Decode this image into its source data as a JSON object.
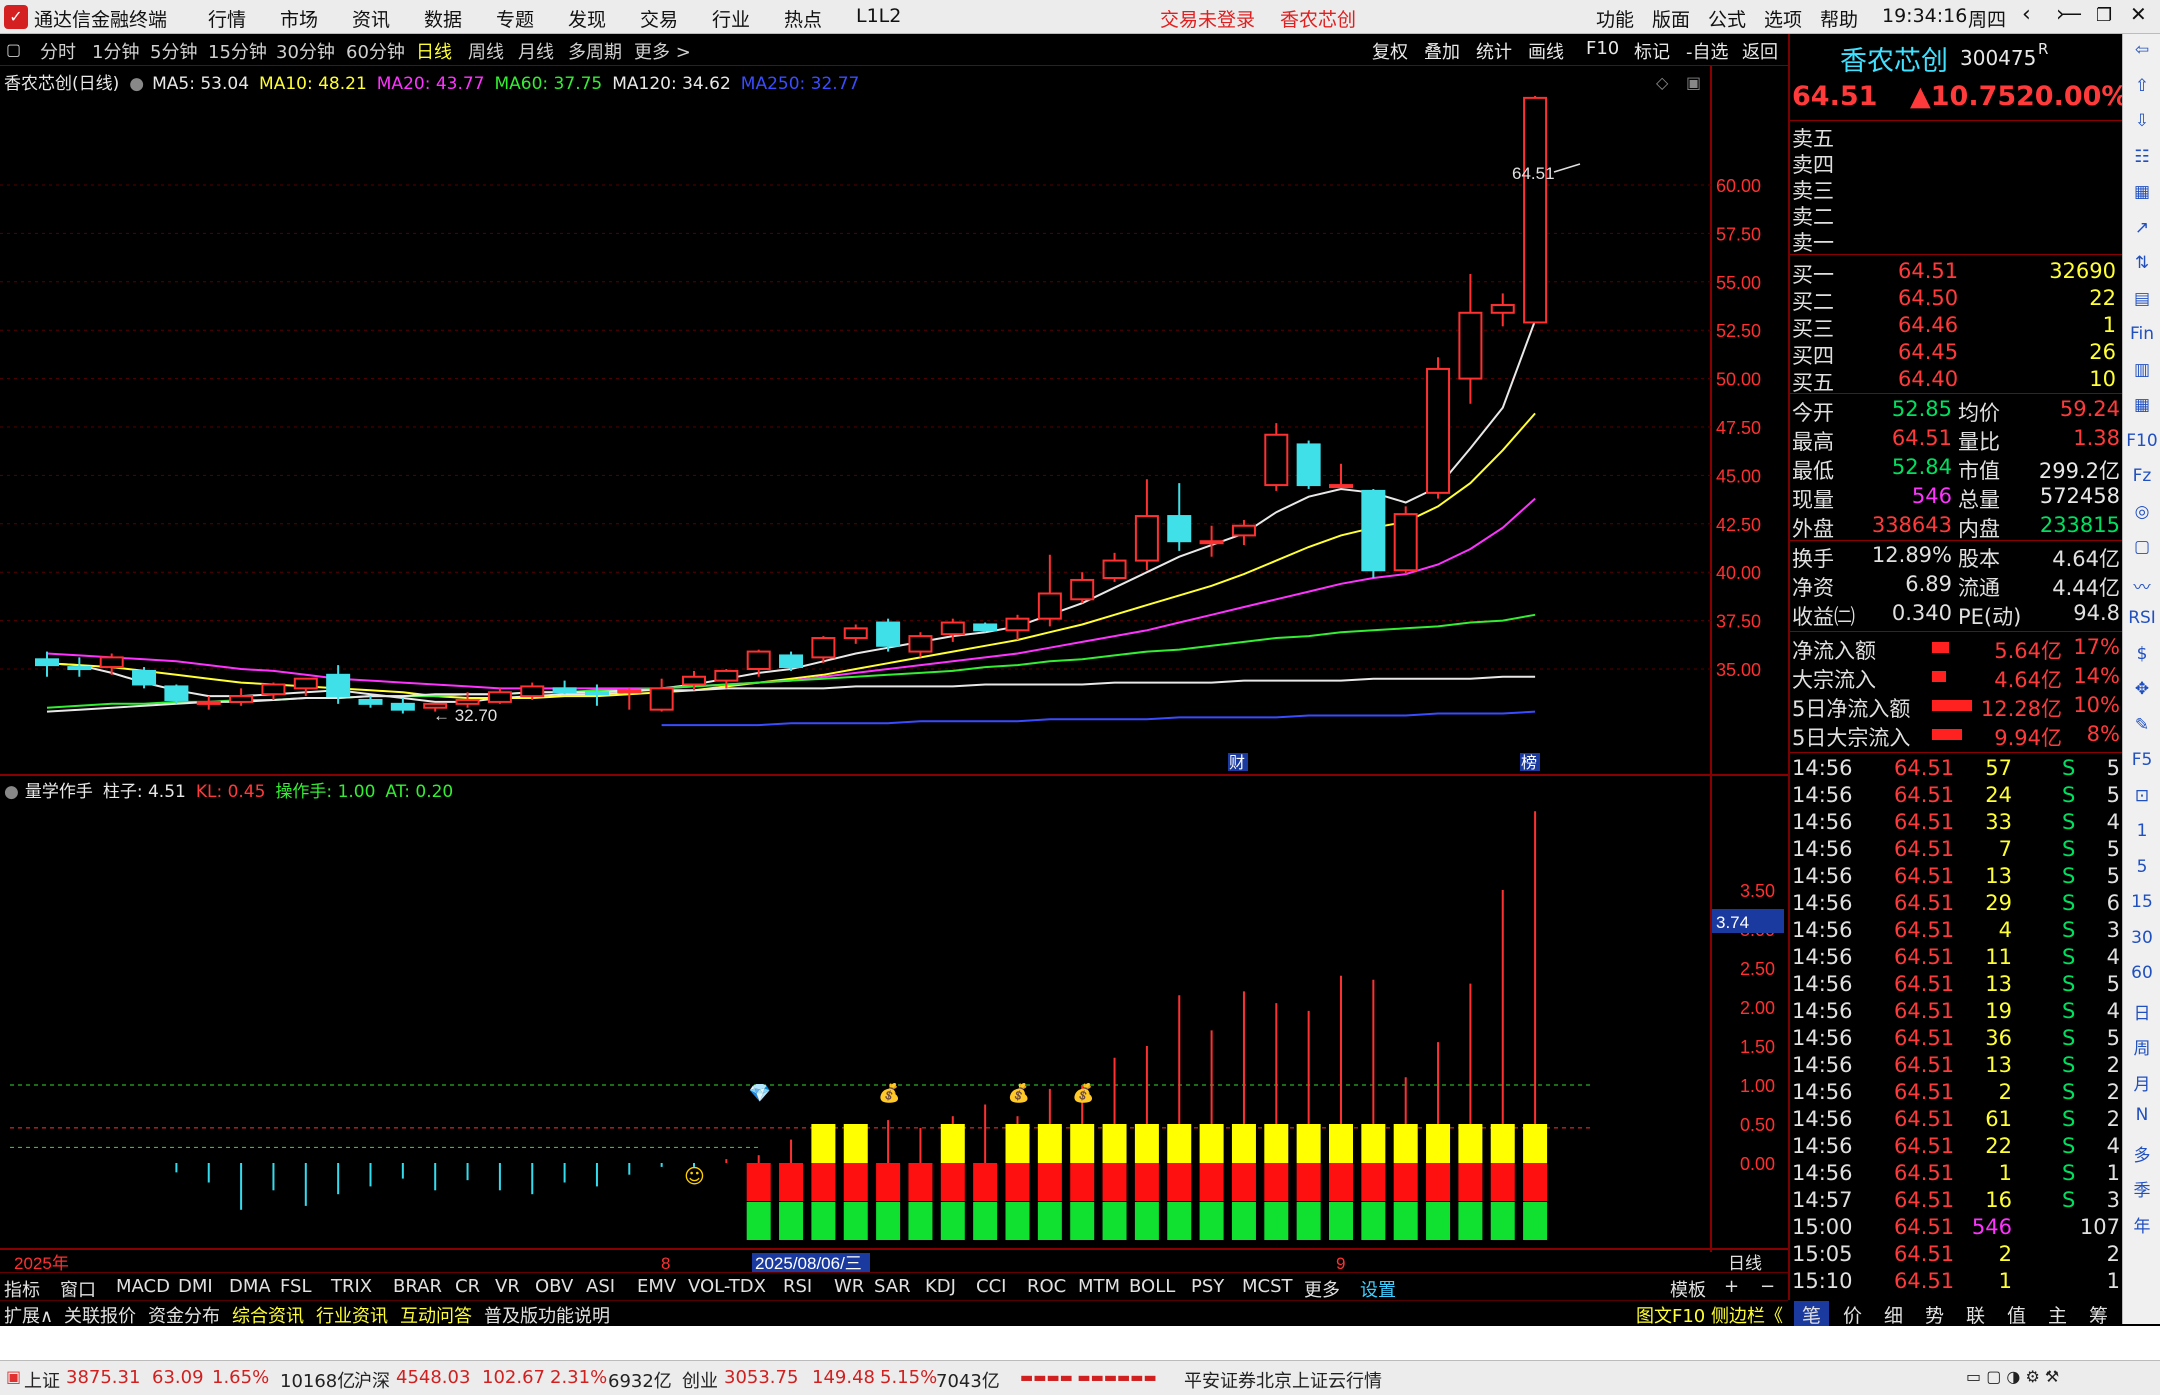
{
  "title_bar": {
    "app_title": "通达信金融终端",
    "menus": [
      "行情",
      "市场",
      "资讯",
      "数据",
      "专题",
      "发现",
      "交易",
      "行业",
      "热点",
      "L1L2"
    ],
    "trade_status": "交易未登录",
    "stock_name": "香农芯创",
    "right_menus": [
      "功能",
      "版面",
      "公式",
      "选项",
      "帮助"
    ],
    "clock": "19:34:16",
    "weekday": "周四"
  },
  "period_bar": {
    "items": [
      "分时",
      "1分钟",
      "5分钟",
      "15分钟",
      "30分钟",
      "60分钟",
      "日线",
      "周线",
      "月线",
      "多周期",
      "更多 >"
    ],
    "active": "日线",
    "right_buttons": [
      "复权",
      "叠加",
      "统计",
      "画线",
      "F10",
      "标记",
      "-自选",
      "返回"
    ]
  },
  "ma_legend": {
    "title": "香农芯创(日线)",
    "items": [
      {
        "label": "MA5: 53.04",
        "color": "#e8e8e8"
      },
      {
        "label": "MA10: 48.21",
        "color": "#ffff33"
      },
      {
        "label": "MA20: 43.77",
        "color": "#ff33ff"
      },
      {
        "label": "MA60: 37.75",
        "color": "#33ee33"
      },
      {
        "label": "MA120: 34.62",
        "color": "#e8e8e8"
      },
      {
        "label": "MA250: 32.77",
        "color": "#3a4cff"
      }
    ]
  },
  "price_axis": [
    "60.00",
    "57.50",
    "55.00",
    "52.50",
    "50.00",
    "47.50",
    "45.00",
    "42.50",
    "40.00",
    "37.50",
    "35.00"
  ],
  "high_label": "64.51",
  "low_label": "32.70",
  "event_tags": [
    "财",
    "榜"
  ],
  "indicator": {
    "name": "量学作手",
    "legend": [
      {
        "label": "柱子: 4.51",
        "color": "#e8e8e8"
      },
      {
        "label": "KL: 0.45",
        "color": "#ff3a3a"
      },
      {
        "label": "操作手: 1.00",
        "color": "#33ee33"
      },
      {
        "label": "AT: 0.20",
        "color": "#33ee33"
      }
    ],
    "axis": [
      "3.50",
      "3.00",
      "2.50",
      "2.00",
      "1.50",
      "1.00",
      "0.50",
      "0.00"
    ],
    "cursor_value": "3.74"
  },
  "date_axis": {
    "year": "2025年",
    "m8": "8",
    "cursor_date": "2025/08/06/三",
    "m9": "9",
    "period": "日线"
  },
  "candles": [
    {
      "o": 35.5,
      "h": 35.9,
      "l": 34.6,
      "c": 35.2
    },
    {
      "o": 35.1,
      "h": 35.6,
      "l": 34.6,
      "c": 35.0
    },
    {
      "o": 35.1,
      "h": 35.8,
      "l": 34.7,
      "c": 35.6
    },
    {
      "o": 34.9,
      "h": 35.1,
      "l": 34.0,
      "c": 34.2
    },
    {
      "o": 34.1,
      "h": 34.2,
      "l": 33.2,
      "c": 33.4
    },
    {
      "o": 33.2,
      "h": 33.6,
      "l": 32.9,
      "c": 33.3
    },
    {
      "o": 33.3,
      "h": 34.0,
      "l": 33.1,
      "c": 33.6
    },
    {
      "o": 33.7,
      "h": 34.3,
      "l": 33.4,
      "c": 34.2
    },
    {
      "o": 34.0,
      "h": 34.5,
      "l": 33.6,
      "c": 34.5
    },
    {
      "o": 34.7,
      "h": 35.2,
      "l": 33.2,
      "c": 33.6
    },
    {
      "o": 33.4,
      "h": 33.6,
      "l": 33.0,
      "c": 33.2
    },
    {
      "o": 33.2,
      "h": 33.5,
      "l": 32.7,
      "c": 32.9
    },
    {
      "o": 33.0,
      "h": 33.2,
      "l": 32.8,
      "c": 33.2
    },
    {
      "o": 33.2,
      "h": 33.8,
      "l": 33.0,
      "c": 33.4
    },
    {
      "o": 33.3,
      "h": 34.0,
      "l": 33.2,
      "c": 33.8
    },
    {
      "o": 33.6,
      "h": 34.3,
      "l": 33.4,
      "c": 34.1
    },
    {
      "o": 34.0,
      "h": 34.4,
      "l": 33.7,
      "c": 33.8
    },
    {
      "o": 33.8,
      "h": 34.2,
      "l": 33.1,
      "c": 33.7
    },
    {
      "o": 33.9,
      "h": 34.0,
      "l": 32.9,
      "c": 33.9
    },
    {
      "o": 32.9,
      "h": 34.5,
      "l": 32.8,
      "c": 34.0
    },
    {
      "o": 34.2,
      "h": 34.9,
      "l": 33.9,
      "c": 34.6
    },
    {
      "o": 34.4,
      "h": 35.0,
      "l": 34.0,
      "c": 34.9
    },
    {
      "o": 35.0,
      "h": 36.0,
      "l": 34.6,
      "c": 35.9
    },
    {
      "o": 35.7,
      "h": 35.9,
      "l": 34.9,
      "c": 35.1
    },
    {
      "o": 35.6,
      "h": 36.7,
      "l": 35.3,
      "c": 36.6
    },
    {
      "o": 36.6,
      "h": 37.3,
      "l": 36.3,
      "c": 37.1
    },
    {
      "o": 37.4,
      "h": 37.6,
      "l": 35.9,
      "c": 36.2
    },
    {
      "o": 35.9,
      "h": 36.9,
      "l": 35.6,
      "c": 36.7
    },
    {
      "o": 36.8,
      "h": 37.6,
      "l": 36.4,
      "c": 37.4
    },
    {
      "o": 37.3,
      "h": 37.4,
      "l": 36.9,
      "c": 37.0
    },
    {
      "o": 37.0,
      "h": 37.8,
      "l": 36.5,
      "c": 37.6
    },
    {
      "o": 37.6,
      "h": 40.9,
      "l": 37.2,
      "c": 38.9
    },
    {
      "o": 38.6,
      "h": 40.0,
      "l": 38.4,
      "c": 39.6
    },
    {
      "o": 39.7,
      "h": 41.0,
      "l": 39.5,
      "c": 40.6
    },
    {
      "o": 40.6,
      "h": 44.8,
      "l": 40.1,
      "c": 42.9
    },
    {
      "o": 42.9,
      "h": 44.6,
      "l": 41.1,
      "c": 41.6
    },
    {
      "o": 41.5,
      "h": 42.4,
      "l": 40.8,
      "c": 41.6
    },
    {
      "o": 41.9,
      "h": 42.7,
      "l": 41.4,
      "c": 42.4
    },
    {
      "o": 44.5,
      "h": 47.7,
      "l": 44.2,
      "c": 47.1
    },
    {
      "o": 46.6,
      "h": 46.8,
      "l": 44.3,
      "c": 44.5
    },
    {
      "o": 44.5,
      "h": 45.6,
      "l": 44.4,
      "c": 44.5
    },
    {
      "o": 44.2,
      "h": 44.3,
      "l": 39.7,
      "c": 40.1
    },
    {
      "o": 40.1,
      "h": 43.4,
      "l": 39.9,
      "c": 43.0
    },
    {
      "o": 44.1,
      "h": 51.1,
      "l": 43.8,
      "c": 50.5
    },
    {
      "o": 50.0,
      "h": 55.4,
      "l": 48.7,
      "c": 53.4
    },
    {
      "o": 53.4,
      "h": 54.4,
      "l": 52.7,
      "c": 53.8
    },
    {
      "o": 52.9,
      "h": 64.6,
      "l": 52.9,
      "c": 64.5
    }
  ],
  "ma_lines": {
    "ma5": [
      35.3,
      35.2,
      34.8,
      34.3,
      33.9,
      33.6,
      33.6,
      33.7,
      33.8,
      33.9,
      33.7,
      33.5,
      33.3,
      33.3,
      33.5,
      33.6,
      33.7,
      33.7,
      33.8,
      34.0,
      34.2,
      34.5,
      34.8,
      35.0,
      35.4,
      35.8,
      36.1,
      36.4,
      36.7,
      36.9,
      37.2,
      37.8,
      38.4,
      39.2,
      40.0,
      40.8,
      41.4,
      42.0,
      43.1,
      43.9,
      44.3,
      44.1,
      43.6,
      44.4,
      46.4,
      48.5,
      53.0
    ],
    "ma10": [
      35.3,
      35.2,
      35.1,
      34.9,
      34.7,
      34.5,
      34.3,
      34.2,
      34.1,
      34.0,
      33.9,
      33.8,
      33.6,
      33.5,
      33.5,
      33.5,
      33.6,
      33.6,
      33.7,
      33.8,
      33.9,
      34.1,
      34.3,
      34.5,
      34.7,
      35.0,
      35.3,
      35.6,
      35.9,
      36.2,
      36.5,
      36.9,
      37.3,
      37.8,
      38.3,
      38.8,
      39.3,
      39.9,
      40.6,
      41.3,
      41.9,
      42.3,
      42.6,
      43.4,
      44.6,
      46.3,
      48.2
    ],
    "ma20": [
      35.8,
      35.7,
      35.6,
      35.5,
      35.4,
      35.2,
      35.0,
      34.9,
      34.7,
      34.5,
      34.4,
      34.3,
      34.2,
      34.1,
      34.0,
      34.0,
      34.0,
      34.0,
      34.0,
      34.0,
      34.1,
      34.2,
      34.3,
      34.4,
      34.6,
      34.8,
      35.0,
      35.2,
      35.4,
      35.6,
      35.8,
      36.1,
      36.4,
      36.7,
      37.0,
      37.4,
      37.8,
      38.2,
      38.6,
      39.0,
      39.4,
      39.7,
      39.9,
      40.4,
      41.2,
      42.3,
      43.8
    ],
    "ma60": [
      33.0,
      33.1,
      33.2,
      33.2,
      33.3,
      33.3,
      33.4,
      33.4,
      33.5,
      33.5,
      33.6,
      33.6,
      33.6,
      33.7,
      33.7,
      33.8,
      33.8,
      33.9,
      33.9,
      34.0,
      34.1,
      34.2,
      34.3,
      34.4,
      34.5,
      34.6,
      34.7,
      34.8,
      34.9,
      35.1,
      35.2,
      35.4,
      35.5,
      35.7,
      35.9,
      36.0,
      36.2,
      36.4,
      36.6,
      36.7,
      36.9,
      37.0,
      37.1,
      37.2,
      37.4,
      37.5,
      37.8
    ],
    "ma120": [
      32.8,
      32.9,
      33.0,
      33.1,
      33.2,
      33.3,
      33.3,
      33.4,
      33.5,
      33.5,
      33.6,
      33.6,
      33.7,
      33.7,
      33.7,
      33.8,
      33.8,
      33.8,
      33.9,
      33.9,
      33.9,
      34.0,
      34.0,
      34.0,
      34.0,
      34.1,
      34.1,
      34.1,
      34.1,
      34.2,
      34.2,
      34.2,
      34.2,
      34.3,
      34.3,
      34.3,
      34.3,
      34.4,
      34.4,
      34.4,
      34.4,
      34.5,
      34.5,
      34.5,
      34.5,
      34.6,
      34.6
    ],
    "ma250": [
      null,
      null,
      null,
      null,
      null,
      null,
      null,
      null,
      null,
      null,
      null,
      null,
      null,
      null,
      null,
      null,
      null,
      null,
      null,
      32.1,
      32.1,
      32.1,
      32.1,
      32.2,
      32.2,
      32.2,
      32.2,
      32.3,
      32.3,
      32.3,
      32.3,
      32.4,
      32.4,
      32.4,
      32.4,
      32.5,
      32.5,
      32.5,
      32.5,
      32.6,
      32.6,
      32.6,
      32.6,
      32.7,
      32.7,
      32.7,
      32.8
    ]
  },
  "indicator_lines": [
    0,
    0,
    0,
    0,
    -0.12,
    -0.25,
    -0.6,
    -0.35,
    -0.55,
    -0.4,
    -0.3,
    -0.2,
    -0.35,
    -0.22,
    -0.35,
    -0.4,
    -0.25,
    -0.3,
    -0.15,
    -0.05,
    -0.05,
    0.05,
    0.1,
    0.3,
    0.4,
    0.5,
    0.55,
    0.45,
    0.6,
    0.75,
    0.6,
    0.95,
    1.0,
    1.35,
    1.5,
    2.15,
    1.7,
    2.2,
    2.05,
    1.95,
    2.4,
    2.35,
    1.1,
    1.55,
    2.3,
    3.5,
    4.51
  ],
  "quote": {
    "name": "香农芯创",
    "code": "300475",
    "tag": "R",
    "price": "64.51",
    "change": "▲10.75",
    "pct": "20.00%",
    "sell_labels": [
      "卖五",
      "卖四",
      "卖三",
      "卖二",
      "卖一"
    ],
    "buy": [
      {
        "label": "买一",
        "price": "64.51",
        "vol": "32690"
      },
      {
        "label": "买二",
        "price": "64.50",
        "vol": "22"
      },
      {
        "label": "买三",
        "price": "64.46",
        "vol": "1"
      },
      {
        "label": "买四",
        "price": "64.45",
        "vol": "26"
      },
      {
        "label": "买五",
        "price": "64.40",
        "vol": "10"
      }
    ],
    "stats1": [
      {
        "l1": "今开",
        "v1": "52.85",
        "c1": "#00e060",
        "l2": "均价",
        "v2": "59.24",
        "c2": "#ff3a3a"
      },
      {
        "l1": "最高",
        "v1": "64.51",
        "c1": "#ff3a3a",
        "l2": "量比",
        "v2": "1.38",
        "c2": "#ff3a3a"
      },
      {
        "l1": "最低",
        "v1": "52.84",
        "c1": "#00e060",
        "l2": "市值",
        "v2": "299.2亿",
        "c2": "#e8e8e8"
      },
      {
        "l1": "现量",
        "v1": "546",
        "c1": "#ff33ff",
        "l2": "总量",
        "v2": "572458",
        "c2": "#e8e8e8"
      },
      {
        "l1": "外盘",
        "v1": "338643",
        "c1": "#ff3a3a",
        "l2": "内盘",
        "v2": "233815",
        "c2": "#00e060"
      }
    ],
    "stats2": [
      {
        "l1": "换手",
        "v1": "12.89%",
        "l2": "股本",
        "v2": "4.64亿"
      },
      {
        "l1": "净资",
        "v1": "6.89",
        "l2": "流通",
        "v2": "4.44亿"
      },
      {
        "l1": "收益㈡",
        "v1": "0.340",
        "l2": "PE(动)",
        "v2": "94.8"
      }
    ],
    "flows": [
      {
        "label": "净流入额",
        "val": "5.64亿",
        "pct": "17%",
        "bar": 0.17
      },
      {
        "label": "大宗流入",
        "val": "4.64亿",
        "pct": "14%",
        "bar": 0.14
      },
      {
        "label": "5日净流入额",
        "val": "12.28亿",
        "pct": "10%",
        "bar": 0.4
      },
      {
        "label": "5日大宗流入",
        "val": "9.94亿",
        "pct": "8%",
        "bar": 0.3
      }
    ],
    "ticks": [
      {
        "t": "14:56",
        "p": "64.51",
        "v": "57",
        "s": "S",
        "n": "5"
      },
      {
        "t": "14:56",
        "p": "64.51",
        "v": "24",
        "s": "S",
        "n": "5"
      },
      {
        "t": "14:56",
        "p": "64.51",
        "v": "33",
        "s": "S",
        "n": "4"
      },
      {
        "t": "14:56",
        "p": "64.51",
        "v": "7",
        "s": "S",
        "n": "5"
      },
      {
        "t": "14:56",
        "p": "64.51",
        "v": "13",
        "s": "S",
        "n": "5"
      },
      {
        "t": "14:56",
        "p": "64.51",
        "v": "29",
        "s": "S",
        "n": "6"
      },
      {
        "t": "14:56",
        "p": "64.51",
        "v": "4",
        "s": "S",
        "n": "3"
      },
      {
        "t": "14:56",
        "p": "64.51",
        "v": "11",
        "s": "S",
        "n": "4"
      },
      {
        "t": "14:56",
        "p": "64.51",
        "v": "13",
        "s": "S",
        "n": "5"
      },
      {
        "t": "14:56",
        "p": "64.51",
        "v": "19",
        "s": "S",
        "n": "4"
      },
      {
        "t": "14:56",
        "p": "64.51",
        "v": "36",
        "s": "S",
        "n": "5"
      },
      {
        "t": "14:56",
        "p": "64.51",
        "v": "13",
        "s": "S",
        "n": "2"
      },
      {
        "t": "14:56",
        "p": "64.51",
        "v": "2",
        "s": "S",
        "n": "2"
      },
      {
        "t": "14:56",
        "p": "64.51",
        "v": "61",
        "s": "S",
        "n": "2"
      },
      {
        "t": "14:56",
        "p": "64.51",
        "v": "22",
        "s": "S",
        "n": "4"
      },
      {
        "t": "14:56",
        "p": "64.51",
        "v": "1",
        "s": "S",
        "n": "1"
      },
      {
        "t": "14:57",
        "p": "64.51",
        "v": "16",
        "s": "S",
        "n": "3"
      },
      {
        "t": "15:00",
        "p": "64.51",
        "v": "546",
        "s": "",
        "n": "107"
      },
      {
        "t": "15:05",
        "p": "64.51",
        "v": "2",
        "s": "",
        "n": "2"
      },
      {
        "t": "15:10",
        "p": "64.51",
        "v": "1",
        "s": "",
        "n": "1"
      }
    ]
  },
  "sidebar_items": [
    "⇦",
    "⇧",
    "⇩",
    "☷",
    "▦",
    "↗",
    "⇅",
    "▤",
    "Fin",
    "▥",
    "▦",
    "F10",
    "Fz",
    "◎",
    "▢",
    "〰",
    "RSI",
    "$",
    "✥",
    "✎",
    "F5",
    "⊡",
    "1",
    "5",
    "15",
    "30",
    "60",
    "日",
    "周",
    "月",
    "N",
    "多",
    "季",
    "年"
  ],
  "indicator_tabs": [
    "指标",
    "窗口",
    "MACD",
    "DMI",
    "DMA",
    "FSL",
    "TRIX",
    "BRAR",
    "CR",
    "VR",
    "OBV",
    "ASI",
    "EMV",
    "VOL-TDX",
    "RSI",
    "WR",
    "SAR",
    "KDJ",
    "CCI",
    "ROC",
    "MTM",
    "BOLL",
    "PSY",
    "MCST",
    "更多",
    "设置"
  ],
  "template_label": "模板",
  "ext_tabs": [
    {
      "label": "扩展∧",
      "color": "#e0e0e0"
    },
    {
      "label": "关联报价",
      "color": "#e0e0e0"
    },
    {
      "label": "资金分布",
      "color": "#e0e0e0"
    },
    {
      "label": "综合资讯",
      "color": "#ffff33"
    },
    {
      "label": "行业资讯",
      "color": "#ffff33"
    },
    {
      "label": "互动问答",
      "color": "#ffff33"
    },
    {
      "label": "普及版功能说明",
      "color": "#e0e0e0"
    }
  ],
  "side_link": "图文F10 侧边栏《",
  "quote_tabs": [
    "笔",
    "价",
    "细",
    "势",
    "联",
    "值",
    "主",
    "筹"
  ],
  "status_bar": {
    "idx1": {
      "name": "上证",
      "val": "3875.31",
      "chg": "63.09",
      "pct": "1.65%",
      "amt": "10168亿"
    },
    "idx2": {
      "name": "沪深",
      "val": "4548.03",
      "chg": "102.67",
      "pct": "2.31%",
      "amt": "6932亿"
    },
    "idx3": {
      "name": "创业",
      "val": "3053.75",
      "chg": "149.48",
      "pct": "5.15%",
      "amt": "7043亿"
    },
    "broker": "平安证券北京上证云行情"
  }
}
